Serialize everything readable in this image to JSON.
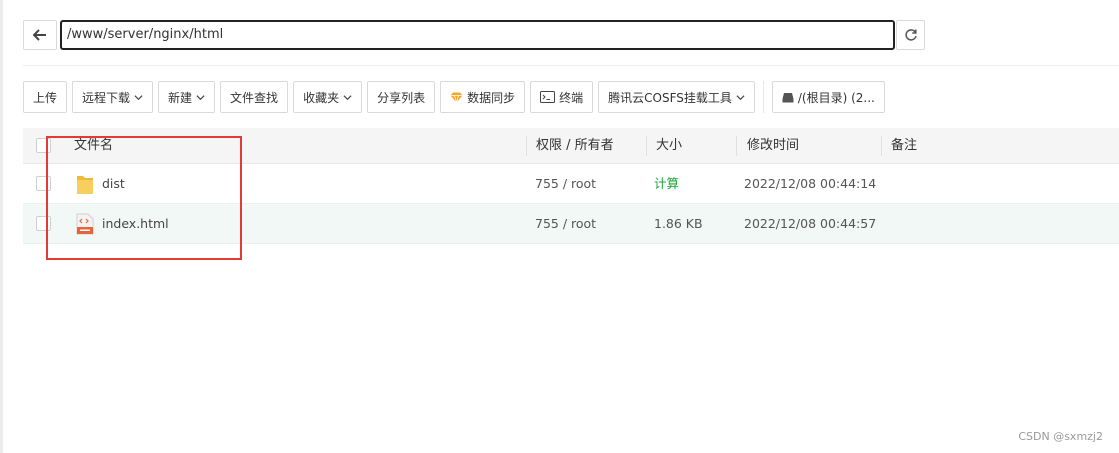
{
  "path": {
    "value": "/www/server/nginx/html"
  },
  "toolbar": {
    "upload": "上传",
    "remote_download": "远程下载",
    "new": "新建",
    "file_search": "文件查找",
    "favorites": "收藏夹",
    "share_list": "分享列表",
    "data_sync": "数据同步",
    "terminal": "终端",
    "cosfs": "腾讯云COSFS挂载工具",
    "disk": "/(根目录) (2..."
  },
  "table": {
    "headers": {
      "name": "文件名",
      "perm": "权限 / 所有者",
      "size": "大小",
      "mtime": "修改时间",
      "note": "备注"
    },
    "rows": [
      {
        "name": "dist",
        "perm": "755 / root",
        "size": "计算",
        "mtime": "2022/12/08 00:44:14",
        "icon": "folder-icon"
      },
      {
        "name": "index.html",
        "perm": "755 / root",
        "size": "1.86 KB",
        "mtime": "2022/12/08 00:44:57",
        "icon": "html-file-icon"
      }
    ]
  },
  "watermark": "CSDN @sxmzj2",
  "colors": {
    "accent_green": "#20a53a",
    "highlight_red": "#e53935",
    "folder_yellow": "#f5c542"
  }
}
